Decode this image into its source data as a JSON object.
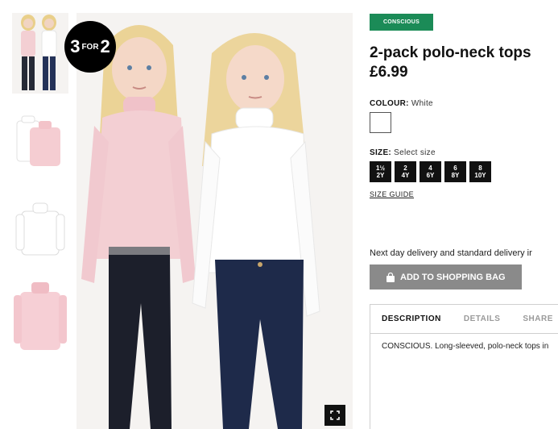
{
  "badge": {
    "big_left": "3",
    "small": "FOR",
    "big_right": "2"
  },
  "product": {
    "tag": "CONSCIOUS",
    "title": "2-pack polo-neck tops",
    "price": "£6.99"
  },
  "colour": {
    "label": "COLOUR:",
    "value": "White"
  },
  "size": {
    "label": "SIZE:",
    "value": "Select size",
    "options": [
      {
        "top": "1½",
        "bottom": "2Y"
      },
      {
        "top": "2",
        "bottom": "4Y"
      },
      {
        "top": "4",
        "bottom": "6Y"
      },
      {
        "top": "6",
        "bottom": "8Y"
      },
      {
        "top": "8",
        "bottom": "10Y"
      }
    ],
    "guide": "SIZE GUIDE"
  },
  "delivery": "Next day delivery and standard delivery ir",
  "add_to_bag": "ADD TO SHOPPING BAG",
  "tabs": [
    "DESCRIPTION",
    "DETAILS",
    "SHARE"
  ],
  "description": "CONSCIOUS. Long-sleeved, polo-neck tops in",
  "colors": {
    "pink_top": "#f3cfd3",
    "jeans_dark": "#1c1f2b",
    "jeans_blue": "#1e2a4a",
    "tag_green": "#1b8b57"
  }
}
